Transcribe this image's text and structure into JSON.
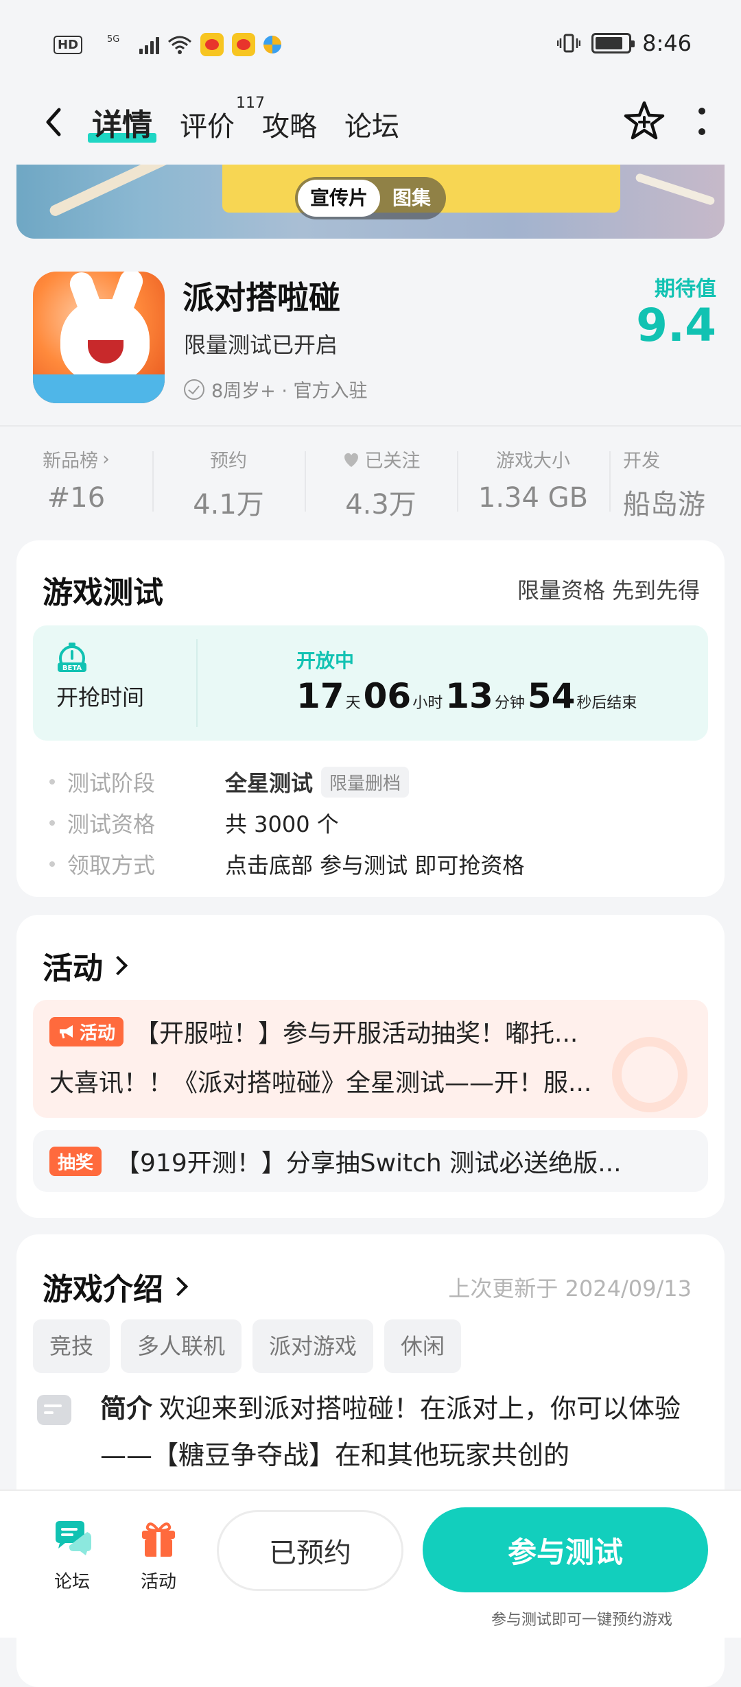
{
  "status_bar": {
    "hd": "HD",
    "net": "5G",
    "time": "8:46",
    "battery_level": 0.85
  },
  "nav": {
    "tabs": [
      {
        "label": "详情",
        "active": true
      },
      {
        "label": "评价",
        "badge": "117"
      },
      {
        "label": "攻略"
      },
      {
        "label": "论坛"
      }
    ]
  },
  "banner": {
    "seg_video": "宣传片",
    "seg_gallery": "图集"
  },
  "app": {
    "name": "派对搭啦碰",
    "subtitle": "限量测试已开启",
    "meta": "8周岁+ · 官方入驻",
    "expect_label": "期待值",
    "expect_value": "9.4",
    "accent": "#11c2b2"
  },
  "stats": [
    {
      "label": "新品榜",
      "value": "#16",
      "arrow": true
    },
    {
      "label": "预约",
      "value": "4.1万"
    },
    {
      "label": "已关注",
      "value": "4.3万",
      "icon": "heart-icon"
    },
    {
      "label": "游戏大小",
      "value": "1.34 GB"
    },
    {
      "label": "开发",
      "value": "船岛游"
    }
  ],
  "test": {
    "title": "游戏测试",
    "side": "限量资格 先到先得",
    "beta": "BETA",
    "grab_label": "开抢时间",
    "open_status": "开放中",
    "countdown": {
      "days": "17",
      "days_unit": "天",
      "hours": "06",
      "hours_unit": "小时",
      "minutes": "13",
      "minutes_unit": "分钟",
      "seconds": "54",
      "seconds_unit": "秒后结束"
    },
    "rows": [
      {
        "key": "测试阶段",
        "value": "全星测试",
        "pill": "限量删档"
      },
      {
        "key": "测试资格",
        "value": "共 3000 个"
      },
      {
        "key": "领取方式",
        "value": "点击底部 参与测试 即可抢资格"
      }
    ]
  },
  "activities": {
    "title": "活动",
    "item1": {
      "badge": "活动",
      "line1": "【开服啦！】参与开服活动抽奖！嘟托...",
      "line2": "大喜讯！！《派对搭啦碰》全星测试——开！服..."
    },
    "item2": {
      "badge": "抽奖",
      "text": "【919开测！】分享抽Switch 测试必送绝版..."
    },
    "badge_color": "#ff6a3d"
  },
  "intro": {
    "title": "游戏介绍",
    "updated": "上次更新于 2024/09/13",
    "tags": [
      "竞技",
      "多人联机",
      "派对游戏",
      "休闲"
    ],
    "label": "简介",
    "text": "欢迎来到派对搭啦碰！在派对上，你可以体验——【糖豆争夺战】在和其他玩家共创的"
  },
  "bottom": {
    "forum": "论坛",
    "activity": "活动",
    "reserved": "已预约",
    "join": "参与测试",
    "hint": "参与测试即可一键预约游戏"
  }
}
